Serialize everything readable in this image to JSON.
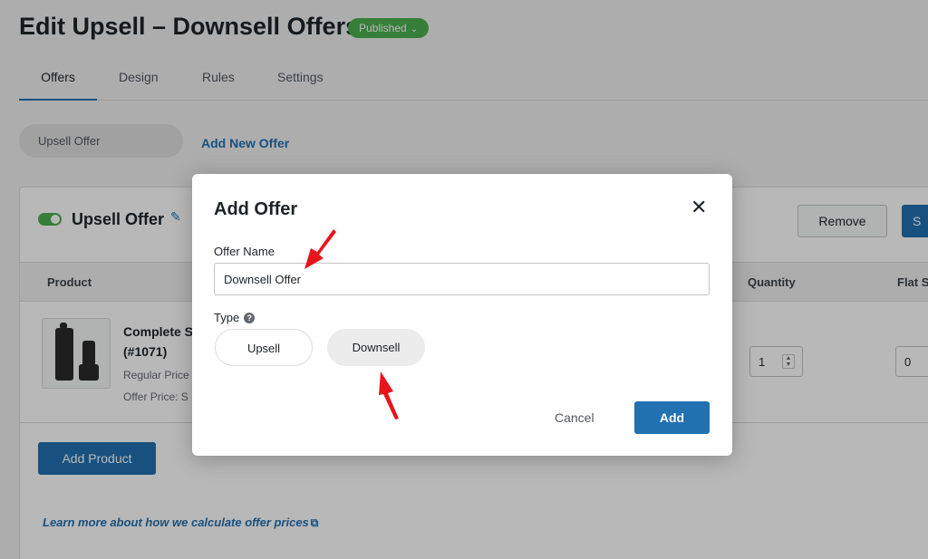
{
  "header": {
    "title": "Edit Upsell – Downsell Offers",
    "status": "Published",
    "status_color": "#4caf50"
  },
  "tabs": [
    {
      "label": "Offers",
      "active": true
    },
    {
      "label": "Design",
      "active": false
    },
    {
      "label": "Rules",
      "active": false
    },
    {
      "label": "Settings",
      "active": false
    }
  ],
  "offers_bar": {
    "current_offer": "Upsell Offer",
    "add_new_label": "Add New Offer"
  },
  "offer_card": {
    "title": "Upsell Offer",
    "enabled": true,
    "remove_label": "Remove",
    "save_label_visible": "S",
    "columns": {
      "product": "Product",
      "quantity": "Quantity",
      "flat": "Flat S"
    },
    "product": {
      "name_line1": "Complete S",
      "name_line2": "(#1071)",
      "regular_price_label": "Regular Price",
      "offer_price_label": "Offer Price: S",
      "quantity": "1",
      "flat_value": "0"
    },
    "add_product_label": "Add Product",
    "learn_more_label": "Learn more about how we calculate offer prices"
  },
  "modal": {
    "title": "Add Offer",
    "offer_name_label": "Offer Name",
    "offer_name_value": "Downsell Offer",
    "type_label": "Type",
    "type_options": [
      "Upsell",
      "Downsell"
    ],
    "selected_type": "Downsell",
    "cancel_label": "Cancel",
    "add_label": "Add"
  },
  "colors": {
    "accent": "#2271b1",
    "annotation_arrow": "#e8141c"
  }
}
